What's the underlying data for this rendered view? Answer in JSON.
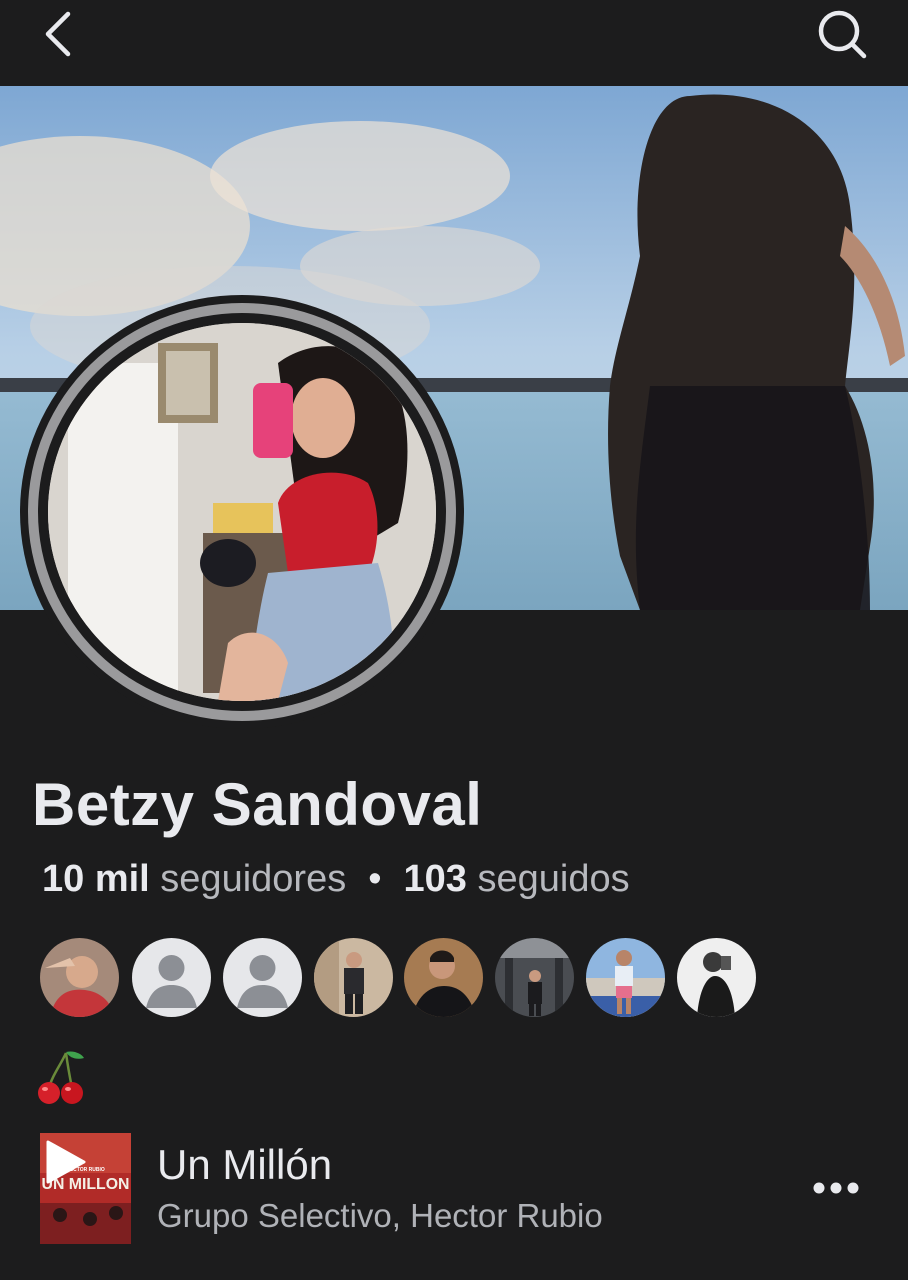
{
  "profile": {
    "name": "Betzy Sandoval",
    "followers_count": "10 mil",
    "followers_label": "seguidores",
    "following_count": "103",
    "following_label": "seguidos",
    "separator": "•",
    "bio_emoji": "🍒"
  },
  "friends": [
    {
      "avatar": "photo"
    },
    {
      "avatar": "default-avatar-icon"
    },
    {
      "avatar": "default-avatar-icon"
    },
    {
      "avatar": "photo"
    },
    {
      "avatar": "photo"
    },
    {
      "avatar": "photo"
    },
    {
      "avatar": "photo"
    },
    {
      "avatar": "photo"
    }
  ],
  "song": {
    "title": "Un Millón",
    "artist": "Grupo Selectivo, Hector Rubio",
    "art_text_main": "UN MILLON",
    "art_text_small": "HECTOR RUBIO"
  },
  "icons": {
    "back": "back-chevron-icon",
    "search": "search-icon",
    "play": "play-icon",
    "more": "more-options-icon"
  },
  "colors": {
    "background": "#1c1c1d",
    "ring": "#9a9a9c",
    "text_primary": "#e9eaee",
    "text_secondary": "#b0b2b7"
  }
}
